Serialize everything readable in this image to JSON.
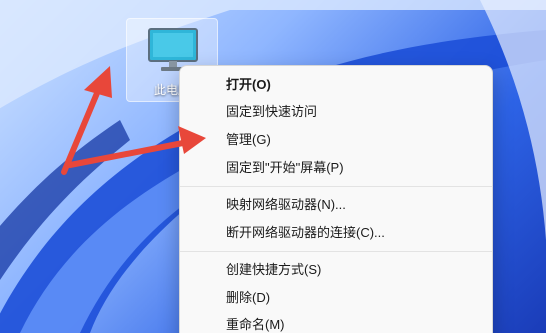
{
  "desktop": {
    "icon_label": "此电脑"
  },
  "context_menu": {
    "group1": [
      {
        "label": "打开(O)",
        "bold": true
      },
      {
        "label": "固定到快速访问",
        "bold": false
      },
      {
        "label": "管理(G)",
        "bold": false
      },
      {
        "label": "固定到\"开始\"屏幕(P)",
        "bold": false
      }
    ],
    "group2": [
      {
        "label": "映射网络驱动器(N)..."
      },
      {
        "label": "断开网络驱动器的连接(C)..."
      }
    ],
    "group3": [
      {
        "label": "创建快捷方式(S)"
      },
      {
        "label": "删除(D)"
      },
      {
        "label": "重命名(M)"
      }
    ]
  },
  "colors": {
    "arrow": "#e8473a",
    "menu_bg": "#f9f9f9",
    "wallpaper_blue": "#2d63e6"
  },
  "icons": {
    "desktop_icon": "monitor-icon"
  }
}
